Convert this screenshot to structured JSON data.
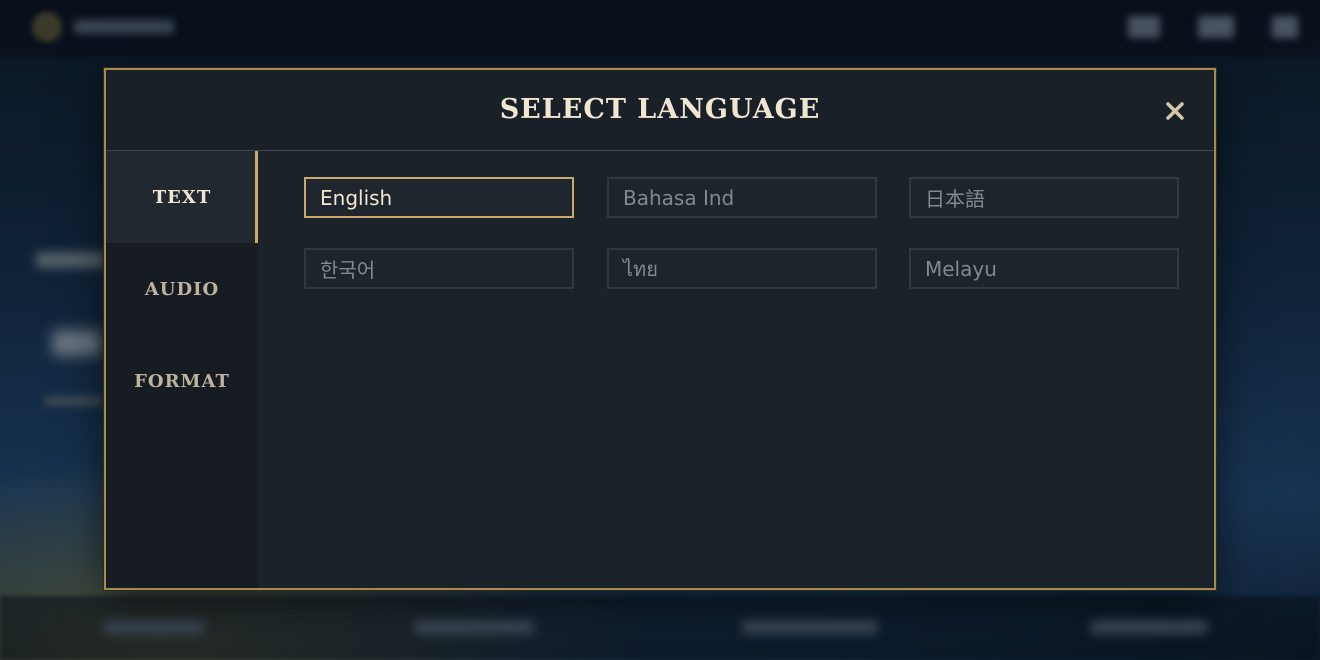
{
  "modal": {
    "title": "SELECT LANGUAGE",
    "close_icon": "close-icon"
  },
  "tabs": [
    {
      "label": "TEXT",
      "active": true
    },
    {
      "label": "AUDIO",
      "active": false
    },
    {
      "label": "FORMAT",
      "active": false
    }
  ],
  "languages": [
    {
      "label": "English",
      "selected": true
    },
    {
      "label": "Bahasa Ind",
      "selected": false
    },
    {
      "label": "日本語",
      "selected": false
    },
    {
      "label": "한국어",
      "selected": false
    },
    {
      "label": "ไทย",
      "selected": false
    },
    {
      "label": "Melayu",
      "selected": false
    }
  ],
  "colors": {
    "accent_gold": "#c8aa6e",
    "modal_border": "#a58b4f",
    "modal_bg": "#1b2128",
    "title_text": "#f0e6d2",
    "inactive_text": "#7f8a92"
  }
}
